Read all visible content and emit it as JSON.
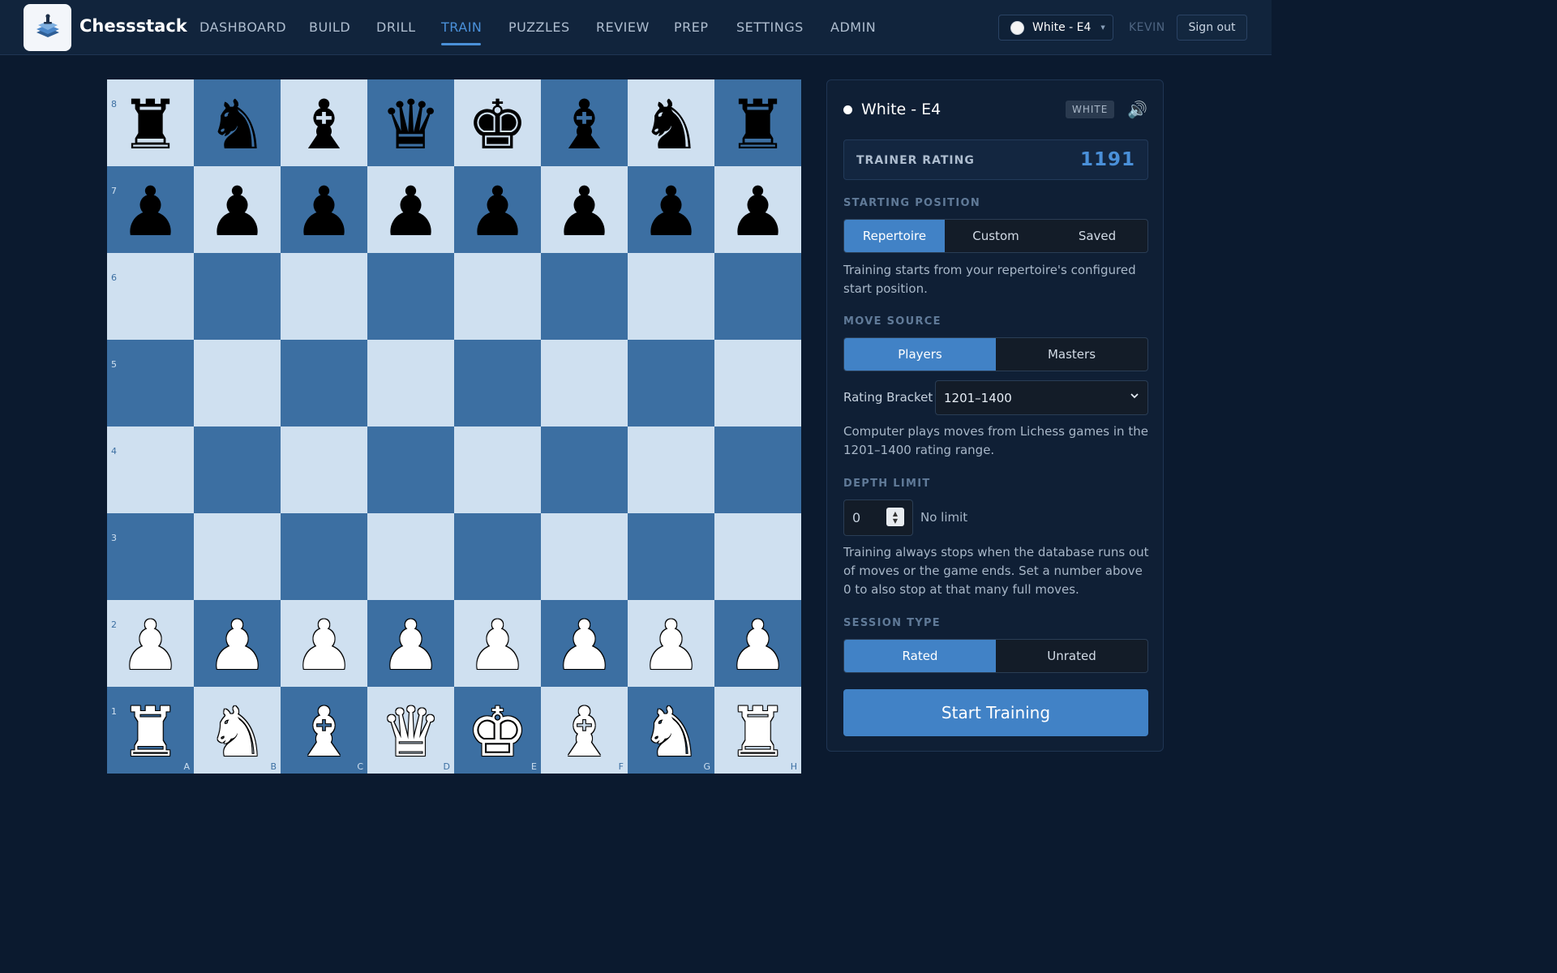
{
  "header": {
    "brand": "Chessstack",
    "nav": [
      {
        "label": "DASHBOARD",
        "active": false
      },
      {
        "label": "BUILD",
        "active": false
      },
      {
        "label": "DRILL",
        "active": false
      },
      {
        "label": "TRAIN",
        "active": true
      },
      {
        "label": "PUZZLES",
        "active": false
      },
      {
        "label": "REVIEW",
        "active": false
      },
      {
        "label": "PREP",
        "active": false
      },
      {
        "label": "SETTINGS",
        "active": false
      },
      {
        "label": "ADMIN",
        "active": false
      }
    ],
    "repertoire_select": "White - E4",
    "user": "KEVIN",
    "sign_out": "Sign out"
  },
  "board": {
    "orientation": "white",
    "ranks": [
      "8",
      "7",
      "6",
      "5",
      "4",
      "3",
      "2",
      "1"
    ],
    "files": [
      "A",
      "B",
      "C",
      "D",
      "E",
      "F",
      "G",
      "H"
    ],
    "position": [
      [
        "br",
        "bn",
        "bb",
        "bq",
        "bk",
        "bb",
        "bn",
        "br"
      ],
      [
        "bp",
        "bp",
        "bp",
        "bp",
        "bp",
        "bp",
        "bp",
        "bp"
      ],
      [
        "",
        "",
        "",
        "",
        "",
        "",
        "",
        ""
      ],
      [
        "",
        "",
        "",
        "",
        "",
        "",
        "",
        ""
      ],
      [
        "",
        "",
        "",
        "",
        "",
        "",
        "",
        ""
      ],
      [
        "",
        "",
        "",
        "",
        "",
        "",
        "",
        ""
      ],
      [
        "wp",
        "wp",
        "wp",
        "wp",
        "wp",
        "wp",
        "wp",
        "wp"
      ],
      [
        "wr",
        "wn",
        "wb",
        "wq",
        "wk",
        "wb",
        "wn",
        "wr"
      ]
    ],
    "colors": {
      "light": "#cfe0f0",
      "dark": "#3c6fa2"
    }
  },
  "panel": {
    "title": "White - E4",
    "color_badge": "WHITE",
    "speaker_icon": "speaker-icon",
    "trainer_rating_label": "TRAINER RATING",
    "trainer_rating_value": "1191",
    "starting_position": {
      "label": "STARTING POSITION",
      "options": [
        "Repertoire",
        "Custom",
        "Saved"
      ],
      "selected": "Repertoire",
      "description": "Training starts from your repertoire's configured start position."
    },
    "move_source": {
      "label": "MOVE SOURCE",
      "options": [
        "Players",
        "Masters"
      ],
      "selected": "Players",
      "rating_bracket_label": "Rating Bracket",
      "rating_bracket_value": "1201–1400",
      "description": "Computer plays moves from Lichess games in the 1201–1400 rating range."
    },
    "depth_limit": {
      "label": "DEPTH LIMIT",
      "value": "0",
      "hint": "No limit",
      "description": "Training always stops when the database runs out of moves or the game ends. Set a number above 0 to also stop at that many full moves."
    },
    "session_type": {
      "label": "SESSION TYPE",
      "options": [
        "Rated",
        "Unrated"
      ],
      "selected": "Rated"
    },
    "start_button": "Start Training"
  },
  "accent_color": "#4182c6"
}
